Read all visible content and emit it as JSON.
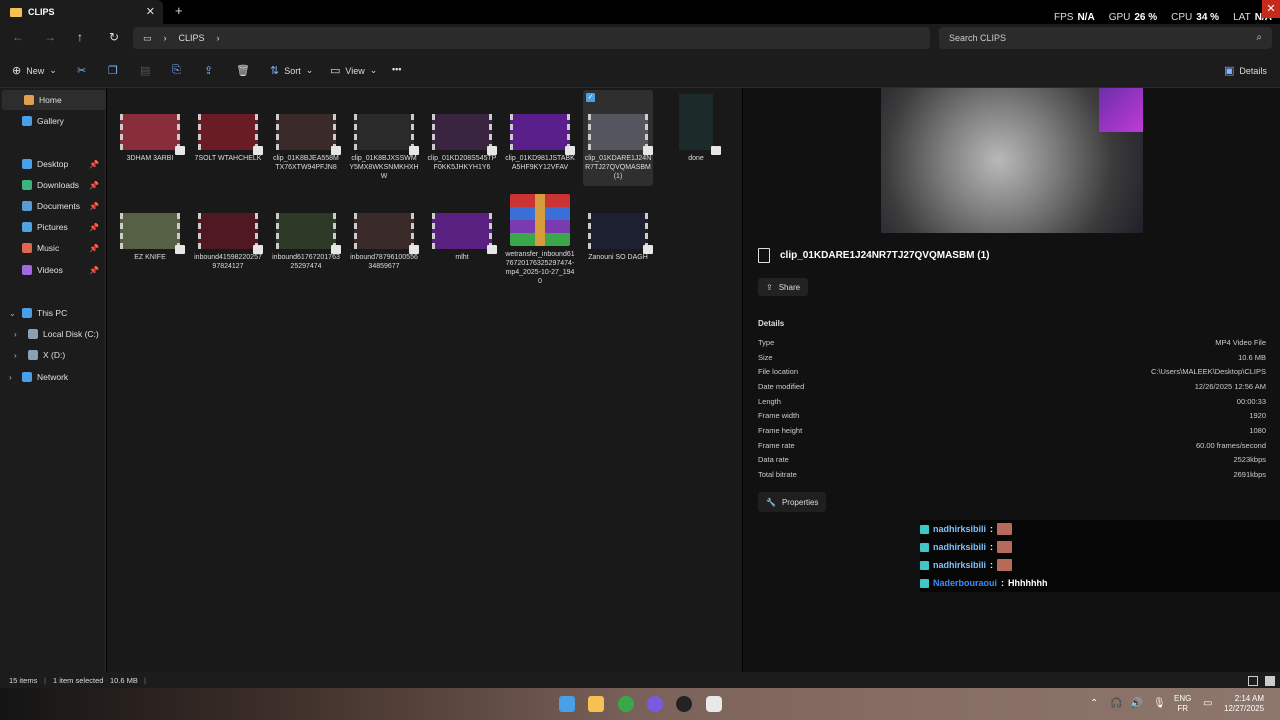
{
  "window": {
    "tab_title": "CLIPS",
    "tab_close": "✕",
    "new_tab": "+"
  },
  "overlay": {
    "fps_label": "FPS",
    "fps_value": "N/A",
    "gpu_label": "GPU",
    "gpu_value": "26 %",
    "cpu_label": "CPU",
    "cpu_value": "34 %",
    "lat_label": "LAT",
    "lat_value": "N/A"
  },
  "nav": {
    "back": "←",
    "forward": "→",
    "up": "↑",
    "refresh": "↻",
    "breadcrumb": [
      "CLIPS"
    ],
    "search_placeholder": "Search CLIPS"
  },
  "toolbar": {
    "new_label": "New",
    "sort_label": "Sort",
    "view_label": "View",
    "more_label": "•••",
    "details_label": "Details"
  },
  "sidebar": {
    "home": "Home",
    "gallery": "Gallery",
    "quick": [
      {
        "label": "Desktop",
        "color": "#4aa0e6"
      },
      {
        "label": "Downloads",
        "color": "#3fb37f"
      },
      {
        "label": "Documents",
        "color": "#5b9bd5"
      },
      {
        "label": "Pictures",
        "color": "#4fa3e0"
      },
      {
        "label": "Music",
        "color": "#e0664f"
      },
      {
        "label": "Videos",
        "color": "#a06ae0"
      }
    ],
    "this_pc": "This PC",
    "local_disk": "Local Disk (C:)",
    "x_drive": "X (D:)",
    "network": "Network"
  },
  "files": [
    {
      "name": "3DHAM 3ARBI",
      "color": "#8a2d3a"
    },
    {
      "name": "7SOLT WTAHCHELK",
      "color": "#6a1c24"
    },
    {
      "name": "clip_01K8BJEA558MTX76XTW94PFJN8",
      "color": "#3a2a2a"
    },
    {
      "name": "clip_01K8BJXSSWMY5MX8WKSNMKHXHW",
      "color": "#2a2a2a"
    },
    {
      "name": "clip_01KD208S545TPF0KK5JHKYH1Y6",
      "color": "#3a2540"
    },
    {
      "name": "clip_01KD981JSTABKA5HF9KY12VFAV",
      "color": "#5a1e8a"
    },
    {
      "name": "clip_01KDARE1J24NR7TJ27QVQMASBM (1)",
      "color": "#555560"
    },
    {
      "name": "done",
      "color": "#1d2a2a"
    },
    {
      "name": "EZ KNIFE",
      "color": "#556045"
    },
    {
      "name": "inbound4159822025797824127",
      "color": "#501820"
    },
    {
      "name": "inbound6176720176325297474",
      "color": "#2d3a28"
    },
    {
      "name": "inbound7879610055634859677",
      "color": "#3a2a2a"
    },
    {
      "name": "mlht",
      "color": "#5a2080"
    },
    {
      "name": "wetransfer_inbound6176720176325297474-mp4_2025-10-27_1940",
      "color": "#c33"
    },
    {
      "name": "Zanouni SO DAGH",
      "color": "#1c2030"
    }
  ],
  "details": {
    "title": "clip_01KDARE1J24NR7TJ27QVQMASBM (1)",
    "share_label": "Share",
    "section": "Details",
    "rows": [
      {
        "k": "Type",
        "v": "MP4 Video File"
      },
      {
        "k": "Size",
        "v": "10.6 MB"
      },
      {
        "k": "File location",
        "v": "C:\\Users\\MALEEK\\Desktop\\CLIPS"
      },
      {
        "k": "Date modified",
        "v": "12/26/2025 12:56 AM"
      },
      {
        "k": "Length",
        "v": "00:00:33"
      },
      {
        "k": "Frame width",
        "v": "1920"
      },
      {
        "k": "Frame height",
        "v": "1080"
      },
      {
        "k": "Frame rate",
        "v": "60.00 frames/second"
      },
      {
        "k": "Data rate",
        "v": "2523kbps"
      },
      {
        "k": "Total bitrate",
        "v": "2691kbps"
      }
    ],
    "properties_label": "Properties"
  },
  "chat": [
    {
      "user": "nadhirksibili",
      "sep": ":",
      "msg": ""
    },
    {
      "user": "nadhirksibili",
      "sep": ":",
      "msg": ""
    },
    {
      "user": "nadhirksibili",
      "sep": ":",
      "msg": ""
    },
    {
      "user": "Naderbouraoui",
      "sep": ":",
      "msg": "Hhhhhhh"
    }
  ],
  "status": {
    "items": "15 items",
    "selected": "1 item selected",
    "size": "10.6 MB"
  },
  "taskbar": {
    "lang1": "ENG",
    "lang2": "FR",
    "time": "2:14 AM",
    "date": "12/27/2025"
  }
}
